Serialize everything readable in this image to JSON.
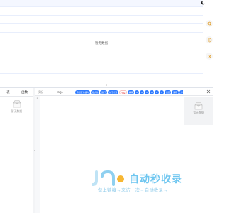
{
  "top_panel": {
    "empty_text": "暂无数据"
  },
  "side_tools": [
    {
      "icon": "search-icon"
    },
    {
      "icon": "settings-icon"
    },
    {
      "icon": "collapse-icon"
    }
  ],
  "left_panel": {
    "tabs": [
      "表",
      "函数"
    ],
    "empty_text": "暂无数据"
  },
  "editor": {
    "toolbar_label_a": "模板",
    "toolbar_label_b": "SQL",
    "chips": [
      "添加查询语句",
      "格式化",
      "运行",
      "执行计划",
      "压缩",
      "解释",
      "历史",
      "当前",
      "A",
      "B",
      "C",
      "D",
      "E",
      "F",
      "设置",
      "保存",
      "分享",
      "收藏",
      "导出",
      "帮助",
      "更多"
    ],
    "line_number": "1"
  },
  "right_panel": {
    "empty_text": "暂无数据"
  },
  "watermark": {
    "title": "自动秒收录",
    "subtitle": "做上链接→来访一次→自动收录→"
  },
  "colors": {
    "accent": "#2f7bff",
    "watermark": "#6ec6f0"
  }
}
